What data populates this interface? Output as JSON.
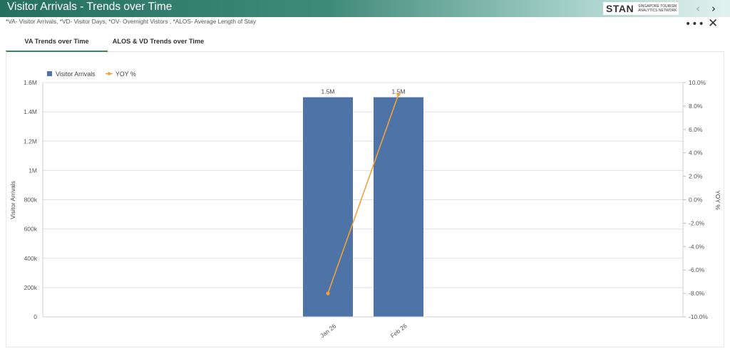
{
  "header": {
    "title": "Visitor Arrivals - Trends over Time",
    "subtitle": "*VA- Visitor Arrivals, *VD- Visitor Days, *OV- Overnight Vistors , *ALOS- Average Length of Stay",
    "logo_mark": "STAN",
    "logo_tagline_1": "SINGAPORE TOURISM",
    "logo_tagline_2": "ANALYTICS NETWORK",
    "prev_icon": "‹",
    "next_icon": "›",
    "more_icon": "•••",
    "close_icon": "✕"
  },
  "tabs": [
    {
      "label": "VA Trends over Time",
      "active": true
    },
    {
      "label": "ALOS & VD Trends over Time",
      "active": false
    }
  ],
  "colors": {
    "bar": "#4e73a6",
    "line": "#f0a13a",
    "accent": "#2e8b57"
  },
  "chart_data": {
    "type": "bar",
    "categories": [
      "Jan 26",
      "Feb 26"
    ],
    "series": [
      {
        "name": "Visitor Arrivals",
        "type": "bar",
        "axis": "left",
        "values": [
          1500000,
          1500000
        ],
        "data_labels": [
          "1.5M",
          "1.5M"
        ]
      },
      {
        "name": "YOY %",
        "type": "line",
        "axis": "right",
        "values": [
          -8.0,
          9.0
        ]
      }
    ],
    "ylabel": "Visitor Arrivals",
    "ylabel_right": "YOY %",
    "ylim": [
      0,
      1600000
    ],
    "ylim_right": [
      -10,
      10
    ],
    "y_ticks": [
      "0",
      "200k",
      "400k",
      "600k",
      "800k",
      "1M",
      "1.2M",
      "1.4M",
      "1.6M"
    ],
    "y_ticks_right": [
      "-10.0%",
      "-8.0%",
      "-6.0%",
      "-4.0%",
      "-2.0%",
      "0.0%",
      "2.0%",
      "4.0%",
      "6.0%",
      "8.0%",
      "10.0%"
    ],
    "grid": true,
    "legend_position": "top-left"
  }
}
